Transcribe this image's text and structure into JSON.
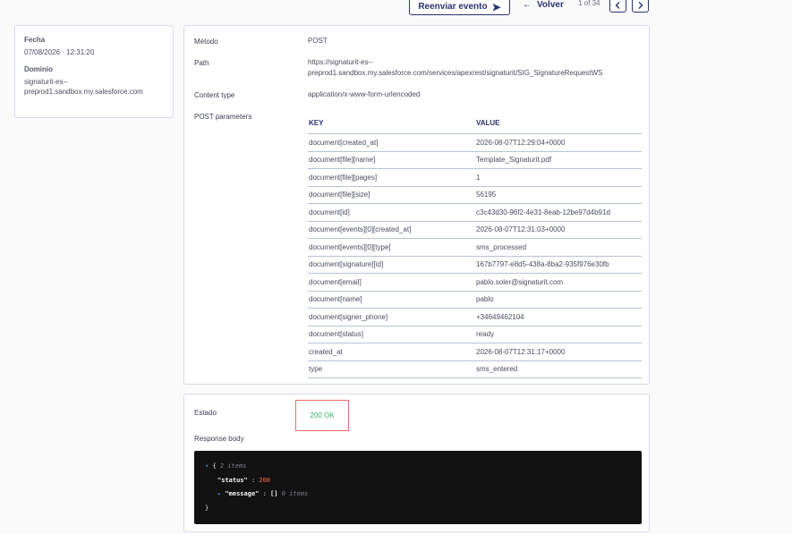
{
  "toolbar": {
    "resend_label": "Reenviar evento",
    "back_label": "Volver",
    "pager_count": "1 of 34"
  },
  "meta": {
    "date_label": "Fecha",
    "date_value": "07/08/2026 · 12:31:20",
    "domain_label": "Dominio",
    "domain_value_1": "signaturit-es--",
    "domain_value_2": "preprod1.sandbox.my.salesforce.com"
  },
  "request": {
    "method_label": "Método",
    "method_value": "POST",
    "path_label": "Path",
    "path_value_1": "https://signaturit-es--",
    "path_value_2": "preprod1.sandbox.my.salesforce.com/services/apexrest/signaturit/SIG_SignatureRequestWS",
    "content_type_label": "Content type",
    "content_type_value": "application/x-www-form-urlencoded",
    "post_params_label": "POST parameters",
    "key_header": "KEY",
    "value_header": "VALUE",
    "params": [
      {
        "key": "document[created_at]",
        "value": "2026-08-07T12:29:04+0000"
      },
      {
        "key": "document[file][name]",
        "value": "Template_Signaturit.pdf"
      },
      {
        "key": "document[file][pages]",
        "value": "1"
      },
      {
        "key": "document[file][size]",
        "value": "56195"
      },
      {
        "key": "document[id]",
        "value": "c3c43d30-96f2-4e31-8eab-12be97d4b91d"
      },
      {
        "key": "document[events][0][created_at]",
        "value": "2026-08-07T12:31:03+0000"
      },
      {
        "key": "document[events][0][type]",
        "value": "sms_processed"
      },
      {
        "key": "document[signature][id]",
        "value": "167b7797-e8d5-438a-8ba2-935f976e30fb"
      },
      {
        "key": "document[email]",
        "value": "pablo.soler@signaturit.com"
      },
      {
        "key": "document[name]",
        "value": "pablo"
      },
      {
        "key": "document[signer_phone]",
        "value": "+34649462104"
      },
      {
        "key": "document[status]",
        "value": "ready"
      },
      {
        "key": "created_at",
        "value": "2026-08-07T12:31:17+0000"
      },
      {
        "key": "type",
        "value": "sms_entered"
      }
    ]
  },
  "response": {
    "status_label": "Estado",
    "status_value": "200 OK",
    "body_label": "Response body",
    "json_open": "{",
    "json_items": "2 items",
    "status_key": "\"status\"",
    "status_num": "200",
    "message_key": "\"message\"",
    "message_val": "[]",
    "message_items": "0 items",
    "json_close": "}"
  }
}
